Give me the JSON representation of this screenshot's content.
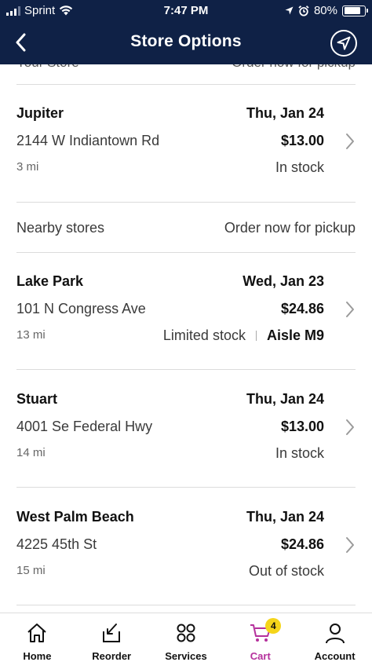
{
  "status_bar": {
    "carrier": "Sprint",
    "time": "7:47 PM",
    "battery": "80%",
    "battery_level": 0.8
  },
  "nav": {
    "title": "Store Options",
    "back_icon": "chevron-left-icon",
    "locate_icon": "location-arrow-icon"
  },
  "partial_row": {
    "left": "Your Store",
    "right": "Order now for pickup"
  },
  "my_store": {
    "name": "Jupiter",
    "date": "Thu, Jan 24",
    "address": "2144 W Indiantown Rd",
    "price": "$13.00",
    "distance": "3 mi",
    "stock": "In stock"
  },
  "nearby_section": {
    "label": "Nearby stores",
    "action": "Order now for pickup"
  },
  "nearby_stores": [
    {
      "name": "Lake Park",
      "date": "Wed, Jan 23",
      "address": "101 N Congress Ave",
      "price": "$24.86",
      "distance": "13 mi",
      "stock": "Limited stock",
      "aisle": "Aisle M9"
    },
    {
      "name": "Stuart",
      "date": "Thu, Jan 24",
      "address": "4001 Se Federal Hwy",
      "price": "$13.00",
      "distance": "14 mi",
      "stock": "In stock"
    },
    {
      "name": "West Palm Beach",
      "date": "Thu, Jan 24",
      "address": "4225 45th St",
      "price": "$24.86",
      "distance": "15 mi",
      "stock": "Out of stock"
    }
  ],
  "tabs": [
    {
      "label": "Home",
      "icon": "home-icon"
    },
    {
      "label": "Reorder",
      "icon": "reorder-icon"
    },
    {
      "label": "Services",
      "icon": "services-icon"
    },
    {
      "label": "Cart",
      "icon": "cart-icon",
      "badge": "4",
      "active": true
    },
    {
      "label": "Account",
      "icon": "account-icon"
    }
  ],
  "colors": {
    "header_bg": "#0f2146",
    "active_tab": "#b5309c",
    "badge": "#f5d51a"
  }
}
